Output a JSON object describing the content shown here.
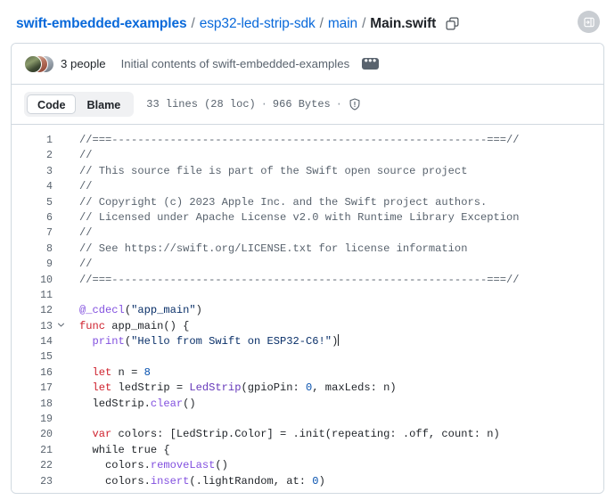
{
  "breadcrumb": {
    "repo": "swift-embedded-examples",
    "sep": "/",
    "folder1": "esp32-led-strip-sdk",
    "folder2": "main",
    "file": "Main.swift",
    "copy_icon": "copy-icon"
  },
  "header": {
    "sidebar_toggle_icon": "sidebar-expand-icon"
  },
  "commit": {
    "people": "3 people",
    "message": "Initial contents of swift-embedded-examples",
    "ellipsis": "•••",
    "avatar_count": 3
  },
  "toolbar": {
    "tab_code": "Code",
    "tab_blame": "Blame",
    "lines": "33 lines (28 loc)",
    "dot": "·",
    "size": "966 Bytes",
    "shield_icon": "shield-warning-icon"
  },
  "colors": {
    "link": "#0969da",
    "border": "#d1d9e0",
    "muted": "#59636e",
    "keyword": "#cf222e",
    "attribute": "#8250df",
    "type": "#6639ba",
    "string": "#0a3069",
    "number": "#0550ae"
  },
  "code": {
    "lines": [
      {
        "n": 1,
        "fold": false,
        "tokens": [
          {
            "t": "//===----------------------------------------------------------===//",
            "c": "tk-comment"
          }
        ]
      },
      {
        "n": 2,
        "fold": false,
        "tokens": [
          {
            "t": "//",
            "c": "tk-comment"
          }
        ]
      },
      {
        "n": 3,
        "fold": false,
        "tokens": [
          {
            "t": "// This source file is part of the Swift open source project",
            "c": "tk-comment"
          }
        ]
      },
      {
        "n": 4,
        "fold": false,
        "tokens": [
          {
            "t": "//",
            "c": "tk-comment"
          }
        ]
      },
      {
        "n": 5,
        "fold": false,
        "tokens": [
          {
            "t": "// Copyright (c) 2023 Apple Inc. and the Swift project authors.",
            "c": "tk-comment"
          }
        ]
      },
      {
        "n": 6,
        "fold": false,
        "tokens": [
          {
            "t": "// Licensed under Apache License v2.0 with Runtime Library Exception",
            "c": "tk-comment"
          }
        ]
      },
      {
        "n": 7,
        "fold": false,
        "tokens": [
          {
            "t": "//",
            "c": "tk-comment"
          }
        ]
      },
      {
        "n": 8,
        "fold": false,
        "tokens": [
          {
            "t": "// See https://swift.org/LICENSE.txt for license information",
            "c": "tk-comment"
          }
        ]
      },
      {
        "n": 9,
        "fold": false,
        "tokens": [
          {
            "t": "//",
            "c": "tk-comment"
          }
        ]
      },
      {
        "n": 10,
        "fold": false,
        "tokens": [
          {
            "t": "//===----------------------------------------------------------===//",
            "c": "tk-comment"
          }
        ]
      },
      {
        "n": 11,
        "fold": false,
        "tokens": []
      },
      {
        "n": 12,
        "fold": false,
        "tokens": [
          {
            "t": "@_cdecl",
            "c": "tk-attr"
          },
          {
            "t": "(",
            "c": "tk-plain"
          },
          {
            "t": "\"app_main\"",
            "c": "tk-string"
          },
          {
            "t": ")",
            "c": "tk-plain"
          }
        ]
      },
      {
        "n": 13,
        "fold": true,
        "tokens": [
          {
            "t": "func",
            "c": "tk-keyword"
          },
          {
            "t": " app_main() {",
            "c": "tk-plain"
          }
        ]
      },
      {
        "n": 14,
        "fold": false,
        "caret": true,
        "tokens": [
          {
            "t": "  ",
            "c": "tk-plain"
          },
          {
            "t": "print",
            "c": "tk-func"
          },
          {
            "t": "(",
            "c": "tk-plain"
          },
          {
            "t": "\"Hello from Swift on ESP32-C6!\"",
            "c": "tk-string"
          },
          {
            "t": ")",
            "c": "tk-plain"
          }
        ]
      },
      {
        "n": 15,
        "fold": false,
        "tokens": []
      },
      {
        "n": 16,
        "fold": false,
        "tokens": [
          {
            "t": "  ",
            "c": "tk-plain"
          },
          {
            "t": "let",
            "c": "tk-keyword"
          },
          {
            "t": " n = ",
            "c": "tk-plain"
          },
          {
            "t": "8",
            "c": "tk-number"
          }
        ]
      },
      {
        "n": 17,
        "fold": false,
        "tokens": [
          {
            "t": "  ",
            "c": "tk-plain"
          },
          {
            "t": "let",
            "c": "tk-keyword"
          },
          {
            "t": " ledStrip = ",
            "c": "tk-plain"
          },
          {
            "t": "LedStrip",
            "c": "tk-type"
          },
          {
            "t": "(gpioPin: ",
            "c": "tk-plain"
          },
          {
            "t": "0",
            "c": "tk-number"
          },
          {
            "t": ", maxLeds: n)",
            "c": "tk-plain"
          }
        ]
      },
      {
        "n": 18,
        "fold": false,
        "tokens": [
          {
            "t": "  ledStrip.",
            "c": "tk-plain"
          },
          {
            "t": "clear",
            "c": "tk-func"
          },
          {
            "t": "()",
            "c": "tk-plain"
          }
        ]
      },
      {
        "n": 19,
        "fold": false,
        "tokens": []
      },
      {
        "n": 20,
        "fold": false,
        "tokens": [
          {
            "t": "  ",
            "c": "tk-plain"
          },
          {
            "t": "var",
            "c": "tk-keyword"
          },
          {
            "t": " colors: [LedStrip.Color] = .init(repeating: .off, count: n)",
            "c": "tk-plain"
          }
        ]
      },
      {
        "n": 21,
        "fold": false,
        "tokens": [
          {
            "t": "  while true {",
            "c": "tk-plain"
          }
        ]
      },
      {
        "n": 22,
        "fold": false,
        "tokens": [
          {
            "t": "    colors.",
            "c": "tk-plain"
          },
          {
            "t": "removeLast",
            "c": "tk-func"
          },
          {
            "t": "()",
            "c": "tk-plain"
          }
        ]
      },
      {
        "n": 23,
        "fold": false,
        "tokens": [
          {
            "t": "    colors.",
            "c": "tk-plain"
          },
          {
            "t": "insert",
            "c": "tk-func"
          },
          {
            "t": "(.lightRandom, at: ",
            "c": "tk-plain"
          },
          {
            "t": "0",
            "c": "tk-number"
          },
          {
            "t": ")",
            "c": "tk-plain"
          }
        ]
      }
    ]
  }
}
